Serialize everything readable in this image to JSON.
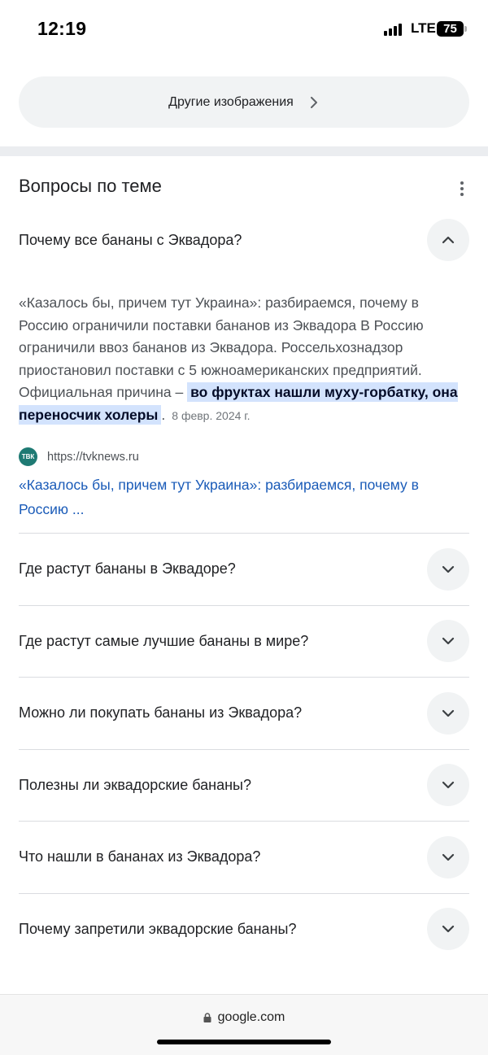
{
  "status_bar": {
    "time": "12:19",
    "network": "LTE",
    "battery": "75"
  },
  "more_images": {
    "label": "Другие изображения"
  },
  "related": {
    "title": "Вопросы по теме",
    "expanded": {
      "question": "Почему все бананы с Эквадора?",
      "answer_text": "«Казалось бы, причем тут Украина»: разбираемся, почему в Россию ограничили поставки бананов из Эквадора В Россию ограничили ввоз бананов из Эквадора. Россельхознадзор приостановил поставки с 5 южноамериканских предприятий. Официальная причина – ",
      "answer_highlight": "во фруктах нашли муху-горбатку, она переносчик холеры",
      "answer_end": ".",
      "date": "8 февр. 2024 г.",
      "source_favicon": "ТВК",
      "source_url": "https://tvknews.ru",
      "source_title": "«Казалось бы, причем тут Украина»: разбираемся, почему в Россию ..."
    },
    "questions": [
      "Где растут бананы в Эквадоре?",
      "Где растут самые лучшие бананы в мире?",
      "Можно ли покупать бананы из Эквадора?",
      "Полезны ли эквадорские бананы?",
      "Что нашли в бананах из Эквадора?",
      "Почему запретили эквадорские бананы?"
    ]
  },
  "bottom_bar": {
    "url": "google.com"
  }
}
